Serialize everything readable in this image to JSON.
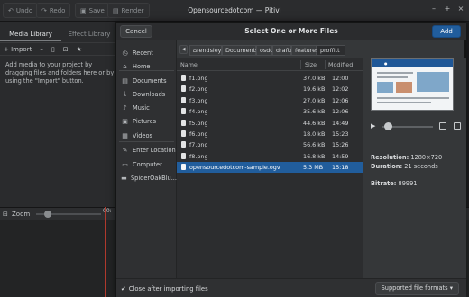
{
  "window": {
    "title": "Opensourcedotcom — Pitivi",
    "undo_label": "Undo",
    "redo_label": "Redo",
    "save_label": "Save",
    "render_label": "Render"
  },
  "left_panel": {
    "tabs": [
      "Media Library",
      "Effect Library"
    ],
    "import_label": "Import",
    "hint": "Add media to your project by dragging files and folders here or by using the \"Import\" button."
  },
  "timeline": {
    "zoom_label": "Zoom",
    "ruler_mark": "00:"
  },
  "dialog": {
    "title": "Select One or More Files",
    "cancel_label": "Cancel",
    "add_label": "Add",
    "places": [
      {
        "label": "Recent",
        "icon": "clock-icon"
      },
      {
        "label": "Home",
        "icon": "home-icon"
      },
      {
        "label": "Documents",
        "icon": "document-icon"
      },
      {
        "label": "Downloads",
        "icon": "download-icon"
      },
      {
        "label": "Music",
        "icon": "music-icon"
      },
      {
        "label": "Pictures",
        "icon": "camera-icon"
      },
      {
        "label": "Videos",
        "icon": "film-icon"
      },
      {
        "label": "Enter Location",
        "icon": "pencil-icon"
      },
      {
        "label": "Computer",
        "icon": "drive-icon"
      },
      {
        "label": "SpiderOakBlu...",
        "icon": "folder-icon"
      }
    ],
    "path": [
      "rendsley",
      "Documents",
      "osdc",
      "drafts",
      "features",
      "proffitt"
    ],
    "columns": {
      "name": "Name",
      "size": "Size",
      "modified": "Modified"
    },
    "files": [
      {
        "name": "f1.png",
        "size": "37.0 kB",
        "modified": "12:00"
      },
      {
        "name": "f2.png",
        "size": "19.6 kB",
        "modified": "12:02"
      },
      {
        "name": "f3.png",
        "size": "27.0 kB",
        "modified": "12:06"
      },
      {
        "name": "f4.png",
        "size": "35.6 kB",
        "modified": "12:06"
      },
      {
        "name": "f5.png",
        "size": "44.6 kB",
        "modified": "14:49"
      },
      {
        "name": "f6.png",
        "size": "18.0 kB",
        "modified": "15:23"
      },
      {
        "name": "f7.png",
        "size": "56.6 kB",
        "modified": "15:26"
      },
      {
        "name": "f8.png",
        "size": "16.8 kB",
        "modified": "14:59"
      },
      {
        "name": "opensourcedotcom-sample.ogv",
        "size": "5.3 MB",
        "modified": "15:18"
      }
    ],
    "selected_index": 8,
    "preview": {
      "resolution_label": "Resolution:",
      "resolution": "1280×720",
      "duration_label": "Duration:",
      "duration": "21 seconds",
      "bitrate_label": "Bitrate:",
      "bitrate": "89991",
      "progress": 0.1
    },
    "close_after_label": "Close after importing files",
    "close_after_checked": true,
    "filter_label": "Supported file formats"
  },
  "colors": {
    "accent": "#215d9c",
    "playhead": "#b03a2e"
  }
}
